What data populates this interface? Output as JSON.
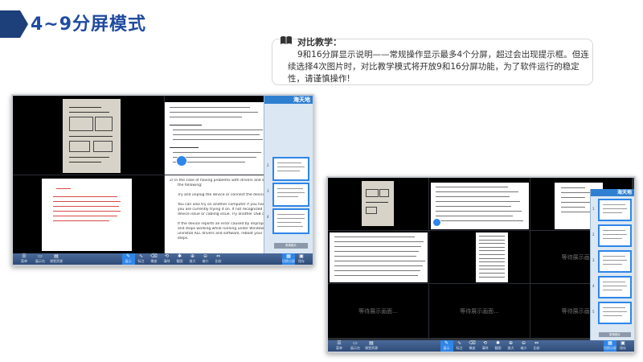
{
  "page": {
    "title": "4~9分屏模式"
  },
  "note": {
    "heading": "对比教学：",
    "body": "9和16分屏显示说明——常规操作显示最多4个分屏，超过会出现提示框。但连续选择4次图片时，对比教学模式将开放9和16分屏功能，为了软件运行的稳定性，请谨慎操作!"
  },
  "screen1": {
    "logo": "海天地",
    "cell3_head": "2)   In the case of having problems with drivers and software",
    "cell3_lines": [
      "the following:",
      "",
      "Try and unplug the device or connect the device to another",
      "",
      "You can also try on another computer if you have exhausted",
      "you are currently trying it on. If not recognized on more",
      "device issue or cabling issue. Try another USB cable if you",
      "",
      "If the device reports an error caused by improper operatio",
      "and stops working while running under Windows 7/8 64",
      "uninstall ALL drivers and software, reboot your PC and try",
      "steps."
    ],
    "cell2_title_lines": [
      "产品用途规范：",
      "适用于白板记录、教学演示等场景",
      "产品介绍说明："
    ]
  },
  "screen2": {
    "logo": "海天地",
    "wait_text": "等待展示画面..."
  },
  "toolbar": {
    "items": [
      "菜单",
      "展示台",
      "课堂资源",
      "展示",
      "标注",
      "橡皮",
      "清除",
      "截图",
      "放大",
      "缩小",
      "比较",
      "",
      "",
      "切换分屏",
      "保存"
    ]
  },
  "side": {
    "footer_label": "更换图片",
    "numbers": [
      "1",
      "2",
      "3",
      "4",
      "5"
    ]
  },
  "colors": {
    "header": "#1d3f7a",
    "accent": "#2f86e8",
    "toolbar": "#3b5a88"
  }
}
